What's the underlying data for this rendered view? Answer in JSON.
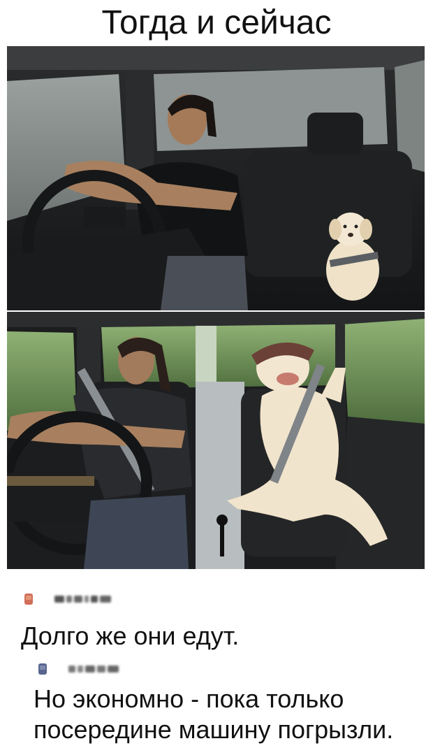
{
  "title": "Тогда и сейчас",
  "photos": {
    "top": {
      "icon": "photo-then-man-driving-puppy"
    },
    "bottom": {
      "icon": "photo-now-man-driving-grown-dog"
    }
  },
  "comments": [
    {
      "avatar_color": "#c8553d",
      "text": "Долго же они едут."
    },
    {
      "avatar_color": "#3b4a7a",
      "text": "Но экономно - пока только посередине машину погрызли."
    }
  ],
  "colors": {
    "text": "#111111",
    "background": "#ffffff"
  }
}
